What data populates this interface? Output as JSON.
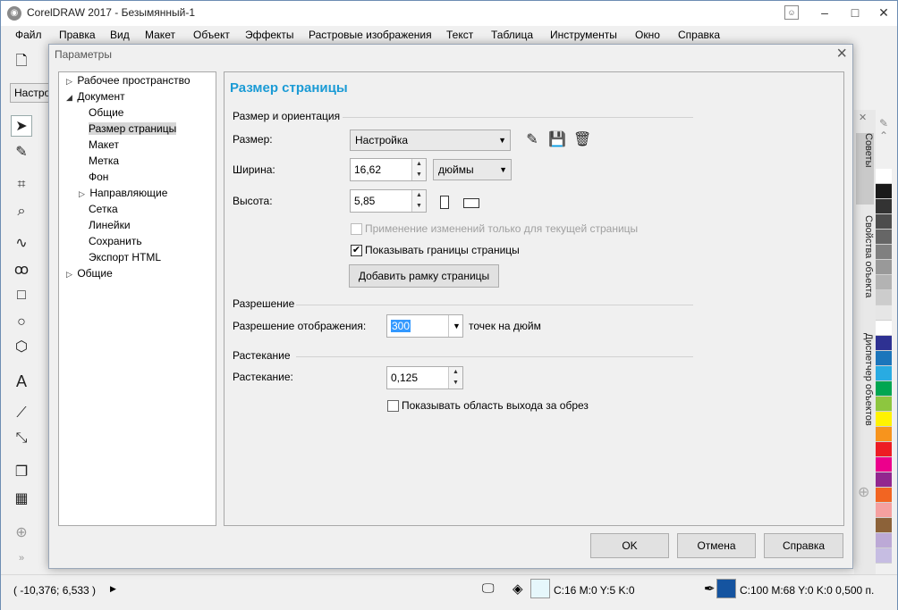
{
  "window": {
    "title": "CorelDRAW 2017 - Безымянный-1",
    "minimize": "–",
    "maximize": "□",
    "close": "✕"
  },
  "menu": [
    "Файл",
    "Правка",
    "Вид",
    "Макет",
    "Объект",
    "Эффекты",
    "Растровые изображения",
    "Текст",
    "Таблица",
    "Инструменты",
    "Окно",
    "Справка"
  ],
  "property_bar": {
    "preset": "Настро"
  },
  "dialog": {
    "title": "Параметры",
    "tree": [
      {
        "label": "Рабочее пространство",
        "twisty": "▷"
      },
      {
        "label": "Документ",
        "twisty": "◢"
      },
      {
        "label": "Общие"
      },
      {
        "label": "Размер страницы",
        "selected": true
      },
      {
        "label": "Макет"
      },
      {
        "label": "Метка"
      },
      {
        "label": "Фон"
      },
      {
        "label": "Направляющие",
        "twisty": "▷"
      },
      {
        "label": "Сетка"
      },
      {
        "label": "Линейки"
      },
      {
        "label": "Сохранить"
      },
      {
        "label": "Экспорт HTML"
      },
      {
        "label": "Общие",
        "twisty": "▷"
      }
    ],
    "panel": {
      "title": "Размер страницы",
      "size_group": "Размер и ориентация",
      "size_label": "Размер:",
      "size_value": "Настройка",
      "width_label": "Ширина:",
      "width_value": "16,62",
      "units_value": "дюймы",
      "height_label": "Высота:",
      "height_value": "5,85",
      "apply_current_only": "Применение изменений только для текущей страницы",
      "show_page_border": "Показывать границы страницы",
      "add_frame_button": "Добавить рамку страницы",
      "resolution_group": "Разрешение",
      "resolution_label": "Разрешение отображения:",
      "resolution_value": "300",
      "resolution_unit": "точек на дюйм",
      "bleed_group": "Растекание",
      "bleed_label": "Растекание:",
      "bleed_value": "0,125",
      "show_bleed": "Показывать область выхода за обрез"
    },
    "buttons": {
      "ok": "OK",
      "cancel": "Отмена",
      "help": "Справка"
    }
  },
  "dockers": {
    "hints": "Советы",
    "object_properties": "Свойства объекта",
    "object_manager": "Диспетчер объектов"
  },
  "status": {
    "coords": "( -10,376; 6,533 )",
    "fill": "C:16 M:0 Y:5 K:0",
    "outline": "C:100 M:68 Y:0 K:0  0,500 п."
  },
  "colors": {
    "accent": "#1b9bd5",
    "fill_swatch": "#e6f7fb",
    "outline_swatch": "#1554a0",
    "palette": [
      "#ffffff",
      "#1a1a1a",
      "#333333",
      "#4d4d4d",
      "#666666",
      "#808080",
      "#999999",
      "#b3b3b3",
      "#cccccc",
      "#e6e6e6",
      "#ffffff",
      "#2e3192",
      "#1b75bb",
      "#29abe2",
      "#00a651",
      "#8dc63f",
      "#fff200",
      "#f7941d",
      "#ed1c24",
      "#ec008c",
      "#92278f",
      "#f26522",
      "#f5a0a0",
      "#8c6239",
      "#bca9d6",
      "#c6bde2"
    ]
  }
}
